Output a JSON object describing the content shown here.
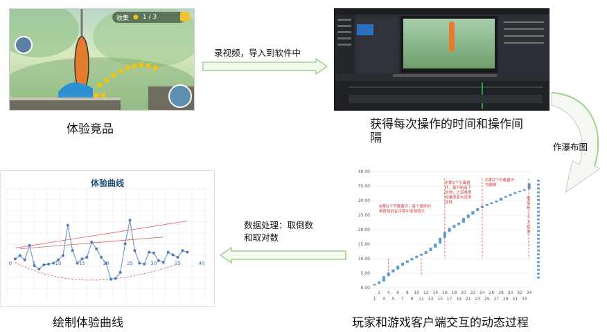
{
  "labels": {
    "experience_product": "体验竞品",
    "record_import": "录视频，导入到软件中",
    "get_time": "获得每次操作的时间和操作间隔",
    "make_waterfall": "作瀑布图",
    "data_processing": "数据处理：取倒数和取对数",
    "draw_curve": "绘制体验曲线",
    "interaction_process": "玩家和游戏客户端交互的动态过程"
  },
  "game_ui": {
    "collect_label": "收集",
    "counter": "1 / 3"
  },
  "waterfall_annotations": {
    "early": "前期3个节奏循环，每个循环的难度级别在平稳中逐渐增大",
    "middle": "中期2个节奏循环，最开始有个松弛，之后难度和难度变化逐渐加快",
    "late": "后期2个节奏循环，均偏难",
    "final": "最后有一个大松弛"
  },
  "colors": {
    "arrow_fill": "#f3faf0",
    "arrow_border": "#9ed08c",
    "bar": "#5b9bd5",
    "trend": "#e06060",
    "curve_title": "#1f4e79"
  },
  "chart_data": [
    {
      "type": "bar",
      "subtype": "waterfall",
      "categories": [
        "1",
        "2",
        "3",
        "4",
        "5",
        "6",
        "7",
        "8",
        "9",
        "10",
        "11",
        "12",
        "13",
        "14",
        "15",
        "16",
        "17",
        "18",
        "19",
        "20",
        "21",
        "22",
        "23",
        "24",
        "25",
        "26",
        "27",
        "28",
        "29",
        "30",
        "31",
        "32",
        "33",
        "34"
      ],
      "x_tick_labels_row1": [
        "2",
        "4",
        "6",
        "8",
        "10",
        "12",
        "14",
        "16",
        "18",
        "20",
        "22",
        "24",
        "26",
        "28",
        "30",
        "32",
        "34"
      ],
      "x_tick_labels_row2": [
        "1",
        "3",
        "5",
        "7",
        "9",
        "11",
        "13",
        "15",
        "17",
        "19",
        "21",
        "23",
        "25",
        "27",
        "29",
        "31",
        "33"
      ],
      "bases": [
        0.8,
        1.3,
        2.2,
        4.0,
        5.3,
        6.3,
        7.6,
        8.6,
        9.4,
        10.2,
        11.0,
        11.7,
        12.6,
        13.8,
        15.2,
        17.2,
        19.2,
        20.6,
        21.6,
        22.4,
        24.0,
        25.2,
        26.4,
        27.4,
        28.2,
        28.8,
        29.4,
        30.0,
        31.0,
        31.6,
        32.3,
        32.9,
        33.4,
        33.9
      ],
      "values": [
        0.5,
        0.9,
        1.8,
        1.3,
        1.0,
        1.3,
        1.0,
        0.8,
        0.8,
        0.8,
        0.7,
        0.9,
        1.2,
        1.4,
        2.0,
        2.0,
        1.4,
        1.0,
        0.8,
        1.6,
        1.2,
        1.2,
        1.0,
        0.8,
        0.6,
        0.6,
        0.6,
        1.0,
        0.6,
        0.7,
        0.6,
        0.5,
        0.5,
        2.0
      ],
      "yticks": [
        "0.00",
        "5.00",
        "10.00",
        "15.00",
        "20.00",
        "25.00",
        "30.00",
        "35.00",
        "40.00"
      ],
      "ylim": [
        0,
        40
      ]
    },
    {
      "type": "line",
      "title": "体验曲线",
      "x": [
        1,
        2,
        3,
        4,
        5,
        6,
        7,
        8,
        9,
        10,
        11,
        12,
        13,
        14,
        15,
        16,
        17,
        18,
        19,
        20,
        21,
        22,
        23,
        24,
        25,
        26,
        27,
        28,
        29,
        30,
        31,
        32,
        33,
        34,
        35,
        36,
        37
      ],
      "y": [
        1.0,
        1.4,
        0.9,
        2.6,
        0.2,
        -0.2,
        0.3,
        0.4,
        0.5,
        0.9,
        1.4,
        5.0,
        2.0,
        0.5,
        1.0,
        1.2,
        3.0,
        2.2,
        1.2,
        0.5,
        -1.4,
        -1.3,
        -0.6,
        2.8,
        5.6,
        2.0,
        0.5,
        0.4,
        1.8,
        1.7,
        0.8,
        0.6,
        1.8,
        1.5,
        1.2,
        2.0,
        1.8
      ],
      "xticks": [
        "0",
        "5",
        "10",
        "15",
        "20",
        "25",
        "30",
        "35",
        "40"
      ],
      "xlim": [
        0,
        40
      ]
    }
  ]
}
